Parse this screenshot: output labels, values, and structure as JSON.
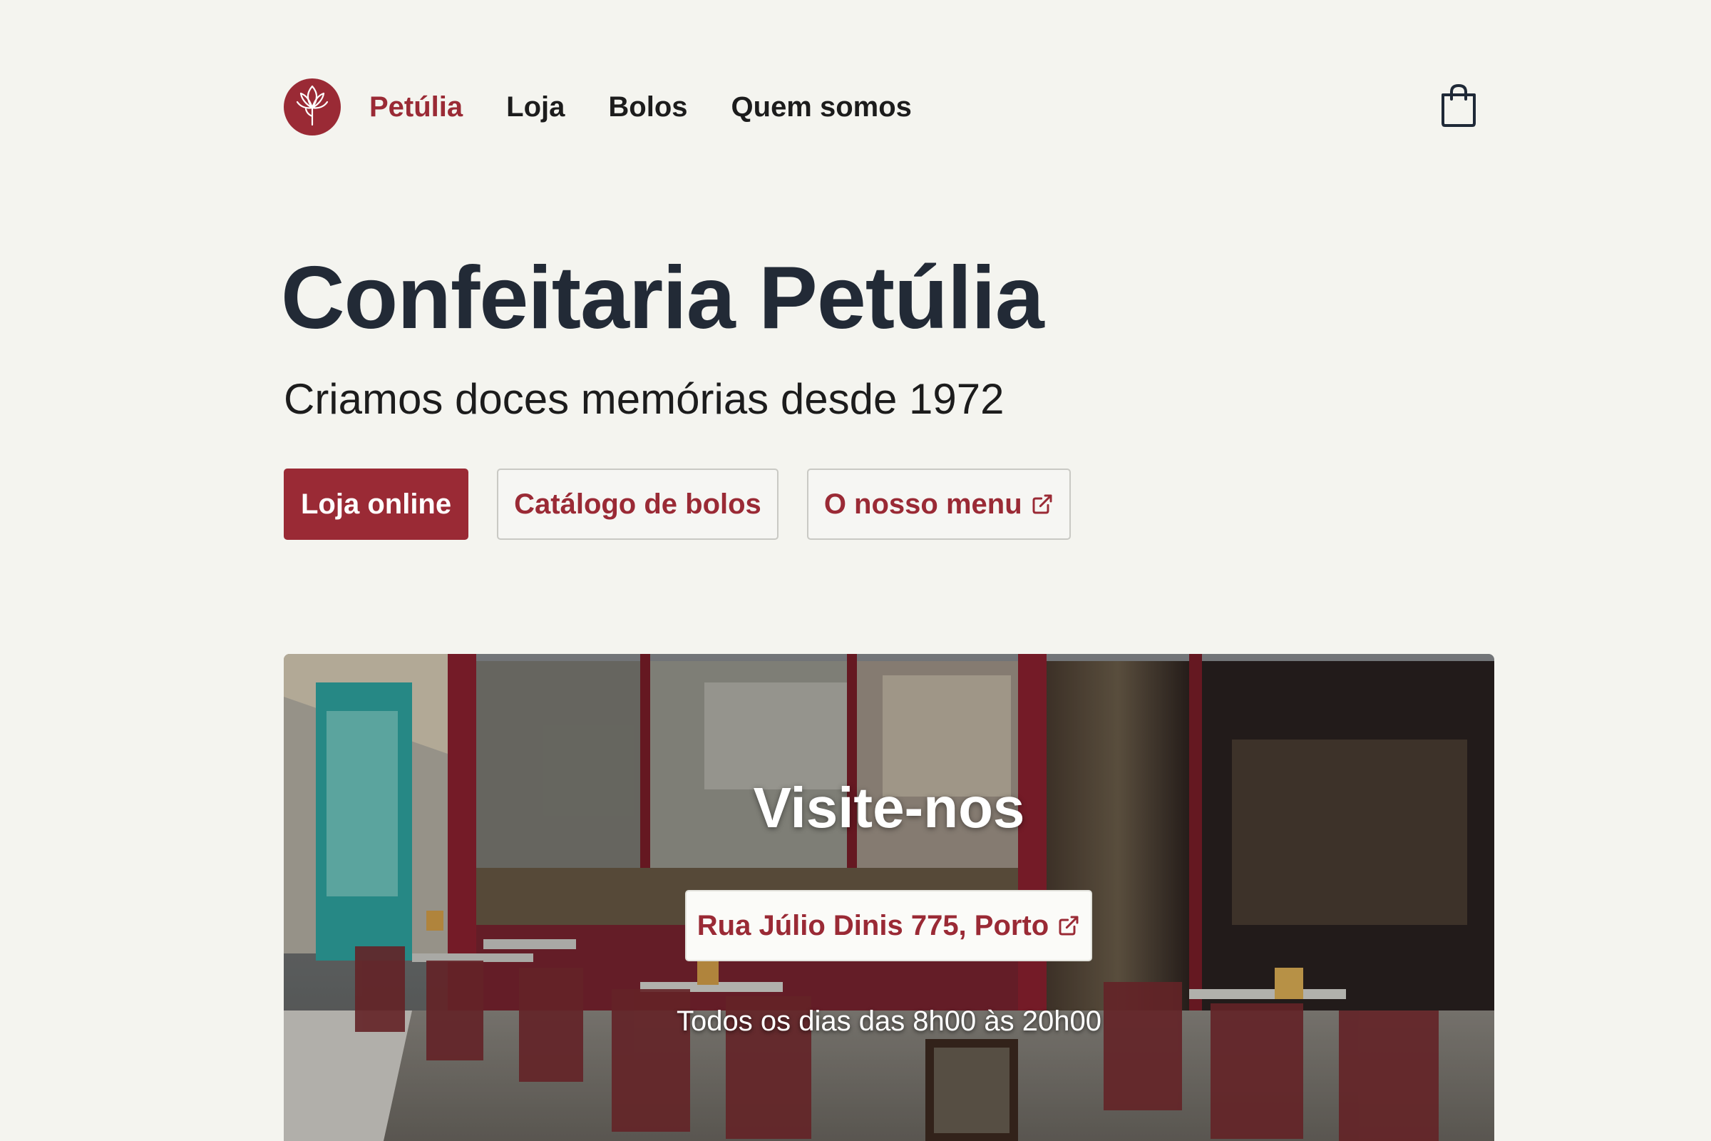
{
  "colors": {
    "brand": "#9a2a35",
    "background": "#f4f4ef",
    "heading": "#222a36"
  },
  "nav": {
    "logo_icon": "lotus-flower-icon",
    "brand": "Petúlia",
    "links": [
      "Loja",
      "Bolos",
      "Quem somos"
    ],
    "cart_icon": "shopping-bag-icon"
  },
  "hero": {
    "title": "Confeitaria Petúlia",
    "subtitle": "Criamos doces memórias desde 1972",
    "buttons": {
      "shop": "Loja online",
      "catalog": "Catálogo de bolos",
      "menu": "O nosso menu"
    },
    "external_icon": "external-link-icon"
  },
  "visit": {
    "title": "Visite-nos",
    "address": "Rua Júlio Dinis 775, Porto",
    "hours": "Todos os dias das 8h00 às 20h00"
  }
}
